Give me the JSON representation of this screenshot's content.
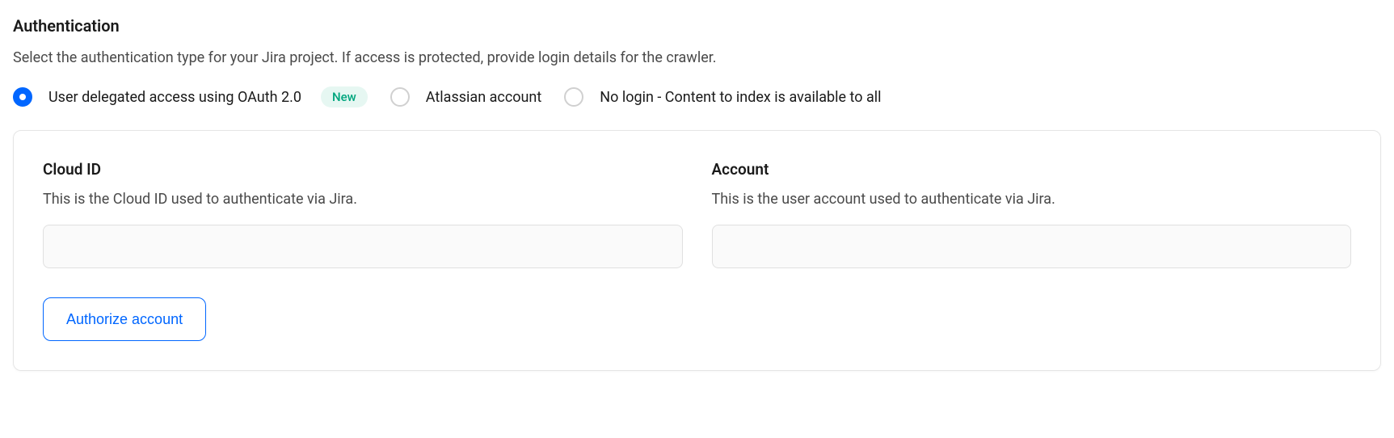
{
  "section": {
    "title": "Authentication",
    "description": "Select the authentication type for your Jira project. If access is protected, provide login details for the crawler."
  },
  "radioOptions": {
    "option1": {
      "label": "User delegated access using OAuth 2.0",
      "badge": "New",
      "selected": true
    },
    "option2": {
      "label": "Atlassian account",
      "selected": false
    },
    "option3": {
      "label": "No login - Content to index is available to all",
      "selected": false
    }
  },
  "fields": {
    "cloudId": {
      "label": "Cloud ID",
      "description": "This is the Cloud ID used to authenticate via Jira.",
      "value": ""
    },
    "account": {
      "label": "Account",
      "description": "This is the user account used to authenticate via Jira.",
      "value": ""
    }
  },
  "actions": {
    "authorize": "Authorize account"
  }
}
